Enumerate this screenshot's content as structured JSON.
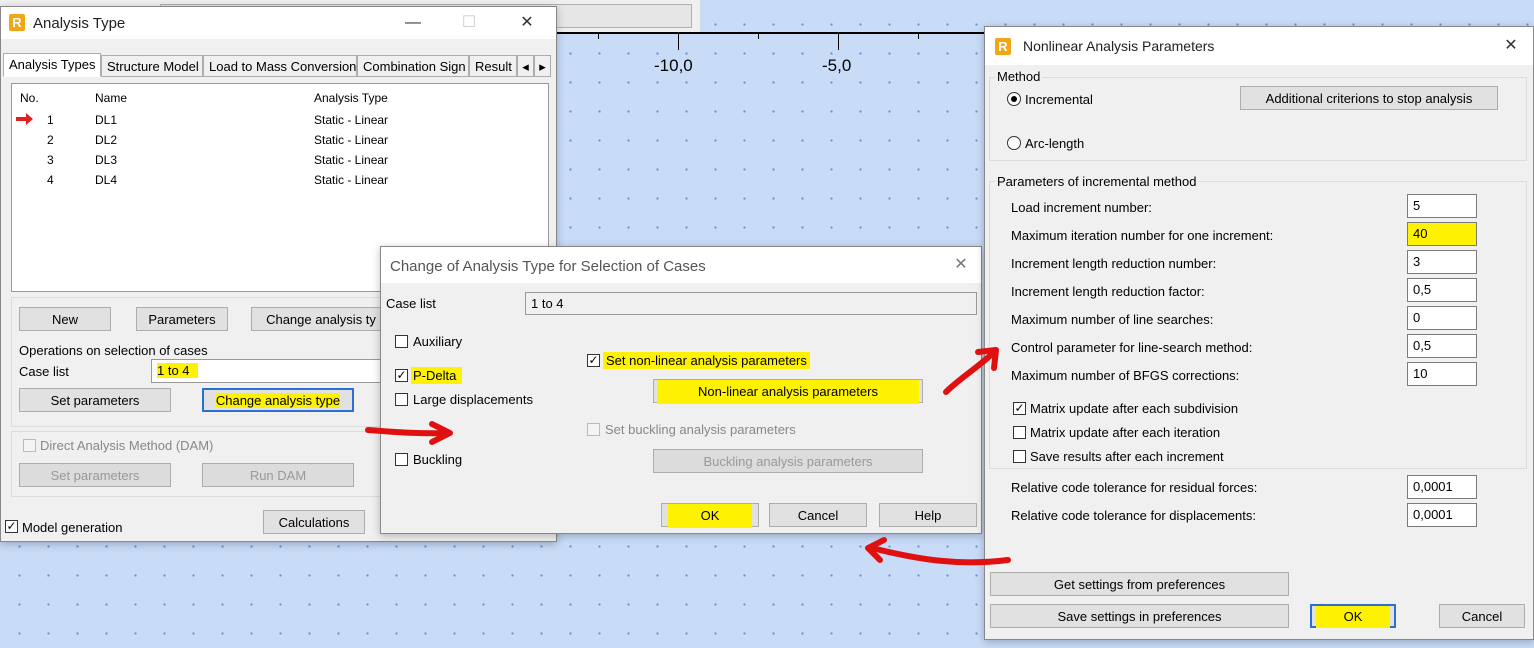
{
  "canvas": {
    "ruler_labels": [
      "-10,0",
      "-5,0"
    ]
  },
  "analysis_type_window": {
    "title": "Analysis Type",
    "tabs": [
      "Analysis Types",
      "Structure Model",
      "Load to Mass Conversion",
      "Combination Sign",
      "Result"
    ],
    "table_headers": [
      "No.",
      "Name",
      "Analysis Type"
    ],
    "rows": [
      {
        "no": "1",
        "name": "DL1",
        "type": "Static - Linear"
      },
      {
        "no": "2",
        "name": "DL2",
        "type": "Static - Linear"
      },
      {
        "no": "3",
        "name": "DL3",
        "type": "Static - Linear"
      },
      {
        "no": "4",
        "name": "DL4",
        "type": "Static - Linear"
      }
    ],
    "buttons": {
      "new": "New",
      "parameters": "Parameters",
      "change_analysis_type": "Change analysis ty",
      "set_parameters": "Set parameters",
      "change_analysis_type2": "Change analysis type",
      "set_parameters_dam": "Set parameters",
      "run_dam": "Run DAM",
      "calculations": "Calculations"
    },
    "ops_group_title": "Operations on selection of cases",
    "case_list_label": "Case list",
    "case_list_value": "1 to 4",
    "dam_label": "Direct Analysis Method (DAM)",
    "model_generation_label": "Model generation"
  },
  "change_dialog": {
    "title": "Change of Analysis Type for Selection of Cases",
    "case_list_label": "Case list",
    "case_list_value": "1 to 4",
    "checkboxes": {
      "auxiliary": "Auxiliary",
      "p_delta": "P-Delta",
      "large_displacements": "Large displacements",
      "buckling": "Buckling",
      "set_nonlinear": "Set non-linear analysis parameters",
      "set_buckling": "Set buckling analysis parameters"
    },
    "buttons": {
      "nonlinear_params": "Non-linear analysis parameters",
      "buckling_params": "Buckling analysis parameters",
      "ok": "OK",
      "cancel": "Cancel",
      "help": "Help"
    }
  },
  "nonlinear_dialog": {
    "title": "Nonlinear Analysis Parameters",
    "method_group": "Method",
    "incremental": "Incremental",
    "arc_length": "Arc-length",
    "additional_criterions": "Additional criterions to stop analysis",
    "params_group": "Parameters of incremental method",
    "params": [
      {
        "label": "Load increment number:",
        "value": "5"
      },
      {
        "label": "Maximum iteration number for one increment:",
        "value": "40"
      },
      {
        "label": "Increment length reduction number:",
        "value": "3"
      },
      {
        "label": "Increment length reduction factor:",
        "value": "0,5"
      },
      {
        "label": "Maximum number of line searches:",
        "value": "0"
      },
      {
        "label": "Control parameter for line-search method:",
        "value": "0,5"
      },
      {
        "label": "Maximum number of BFGS corrections:",
        "value": "10"
      }
    ],
    "checks": {
      "matrix_subdivision": "Matrix update after each subdivision",
      "matrix_iteration": "Matrix update after each iteration",
      "save_results": "Save results after each increment"
    },
    "tolerances": [
      {
        "label": "Relative code tolerance for residual forces:",
        "value": "0,0001"
      },
      {
        "label": "Relative code tolerance for displacements:",
        "value": "0,0001"
      }
    ],
    "buttons": {
      "get_settings": "Get settings from preferences",
      "save_settings": "Save settings in preferences",
      "ok": "OK",
      "cancel": "Cancel"
    }
  }
}
